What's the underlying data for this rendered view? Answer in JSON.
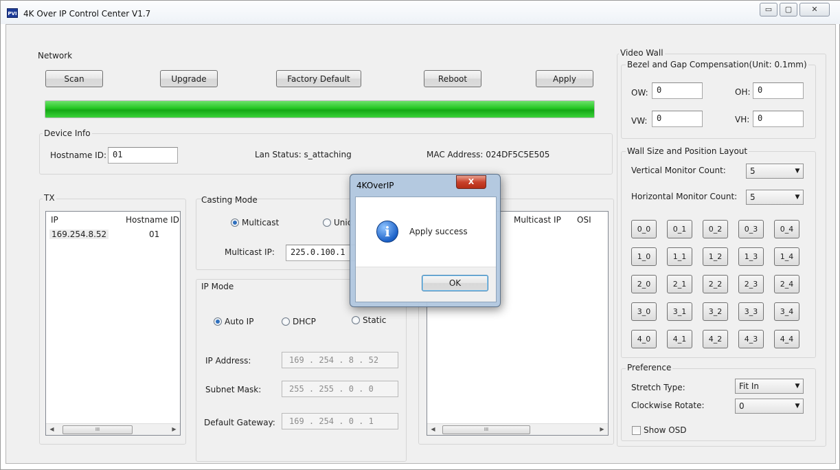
{
  "window": {
    "title": "4K Over IP Control Center V1.7",
    "icon_text": "PVI",
    "min_glyph": "▭",
    "max_glyph": "▢",
    "close_glyph": "✕"
  },
  "network": {
    "label": "Network",
    "buttons": {
      "scan": "Scan",
      "upgrade": "Upgrade",
      "factory_default": "Factory Default",
      "reboot": "Reboot",
      "apply": "Apply"
    },
    "progress": 1.0,
    "progress_color": "#22c521"
  },
  "device_info": {
    "label": "Device Info",
    "hostname_label": "Hostname ID:",
    "hostname_value": "01",
    "lan_status": "Lan Status: s_attaching",
    "mac": "MAC Address: 024DF5C5E505"
  },
  "tx": {
    "label": "TX",
    "columns": [
      "IP",
      "Hostname ID"
    ],
    "rows": [
      {
        "ip": "169.254.8.52",
        "hostname": "01"
      }
    ],
    "scroll_thumb": "III"
  },
  "casting_mode": {
    "label": "Casting Mode",
    "multicast": "Multicast",
    "unicast": "Unic",
    "multicast_ip_label": "Multicast IP:",
    "multicast_ip": "225.0.100.1"
  },
  "ip_mode": {
    "label": "IP Mode",
    "auto": "Auto IP",
    "dhcp": "DHCP",
    "static": "Static",
    "ip_label": "IP Address:",
    "ip_value": "169 . 254 . 8 . 52",
    "mask_label": "Subnet Mask:",
    "mask_value": "255 . 255 . 0 . 0",
    "gw_label": "Default Gateway:",
    "gw_value": "169 . 254 . 0 . 1"
  },
  "rx": {
    "columns": [
      "Multicast IP",
      "OSI"
    ],
    "scroll_thumb": "III"
  },
  "video_wall": {
    "label": "Video Wall",
    "bezel_label": "Bezel and Gap Compensation(Unit: 0.1mm)",
    "ow_label": "OW:",
    "ow_value": "0",
    "oh_label": "OH:",
    "oh_value": "0",
    "vw_label": "VW:",
    "vw_value": "0",
    "vh_label": "VH:",
    "vh_value": "0",
    "layout_label": "Wall Size and Position Layout",
    "vertical_label": "Vertical Monitor Count:",
    "vertical_value": "5",
    "horizontal_label": "Horizontal Monitor Count:",
    "horizontal_value": "5",
    "grid": [
      [
        "0_0",
        "0_1",
        "0_2",
        "0_3",
        "0_4"
      ],
      [
        "1_0",
        "1_1",
        "1_2",
        "1_3",
        "1_4"
      ],
      [
        "2_0",
        "2_1",
        "2_2",
        "2_3",
        "2_4"
      ],
      [
        "3_0",
        "3_1",
        "3_2",
        "3_3",
        "3_4"
      ],
      [
        "4_0",
        "4_1",
        "4_2",
        "4_3",
        "4_4"
      ]
    ],
    "preference_label": "Preference",
    "stretch_label": "Stretch Type:",
    "stretch_value": "Fit In",
    "rotate_label": "Clockwise Rotate:",
    "rotate_value": "0",
    "show_osd": "Show OSD"
  },
  "dialog": {
    "title": "4KOverIP",
    "message": "Apply success",
    "ok": "OK",
    "close_glyph": "X",
    "info_glyph": "i"
  },
  "glyphs": {
    "arrow_left": "◀",
    "arrow_right": "▶",
    "dropdown": "▼"
  }
}
